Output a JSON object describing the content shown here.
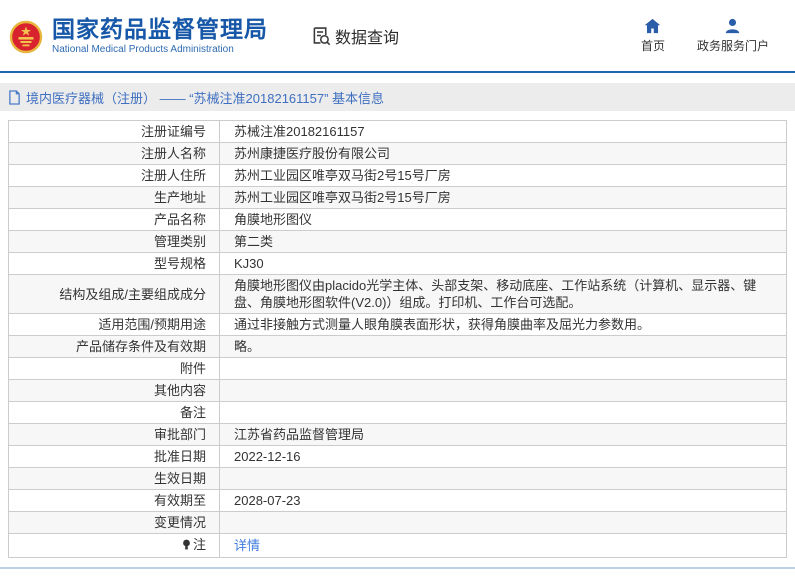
{
  "header": {
    "title": "国家药品监督管理局",
    "subtitle": "National Medical Products Administration",
    "section_label": "数据查询",
    "nav": [
      {
        "label": "首页",
        "icon": "home-icon"
      },
      {
        "label": "政务服务门户",
        "icon": "user-icon"
      }
    ]
  },
  "breadcrumb": {
    "text": "境内医疗器械（注册） —— “苏械注准20182161157” 基本信息"
  },
  "table": {
    "rows": [
      {
        "label": "注册证编号",
        "value": "苏械注准20182161157"
      },
      {
        "label": "注册人名称",
        "value": "苏州康捷医疗股份有限公司"
      },
      {
        "label": "注册人住所",
        "value": "苏州工业园区唯亭双马街2号15号厂房"
      },
      {
        "label": "生产地址",
        "value": "苏州工业园区唯亭双马街2号15号厂房"
      },
      {
        "label": "产品名称",
        "value": "角膜地形图仪"
      },
      {
        "label": "管理类别",
        "value": "第二类"
      },
      {
        "label": "型号规格",
        "value": "KJ30"
      },
      {
        "label": "结构及组成/主要组成成分",
        "value": "角膜地形图仪由placido光学主体、头部支架、移动底座、工作站系统（计算机、显示器、键盘、角膜地形图软件(V2.0)）组成。打印机、工作台可选配。"
      },
      {
        "label": "适用范围/预期用途",
        "value": "通过非接触方式测量人眼角膜表面形状，获得角膜曲率及屈光力参数用。"
      },
      {
        "label": "产品储存条件及有效期",
        "value": "略。"
      },
      {
        "label": "附件",
        "value": ""
      },
      {
        "label": "其他内容",
        "value": ""
      },
      {
        "label": "备注",
        "value": ""
      },
      {
        "label": "审批部门",
        "value": "江苏省药品监督管理局"
      },
      {
        "label": "批准日期",
        "value": "2022-12-16"
      },
      {
        "label": "生效日期",
        "value": ""
      },
      {
        "label": "有效期至",
        "value": "2028-07-23"
      },
      {
        "label": "变更情况",
        "value": ""
      },
      {
        "label": "注",
        "value": "详情"
      }
    ]
  },
  "colors": {
    "accent_blue": "#2166b1",
    "title_blue": "#1657a7",
    "link_blue": "#3e7bdf",
    "breadcrumb_text": "#3f6fc1",
    "row_alt_bg": "#f7f7f7",
    "border_gray": "#cccccc",
    "emblem_red": "#d8222e",
    "emblem_gold": "#e9b63d"
  }
}
